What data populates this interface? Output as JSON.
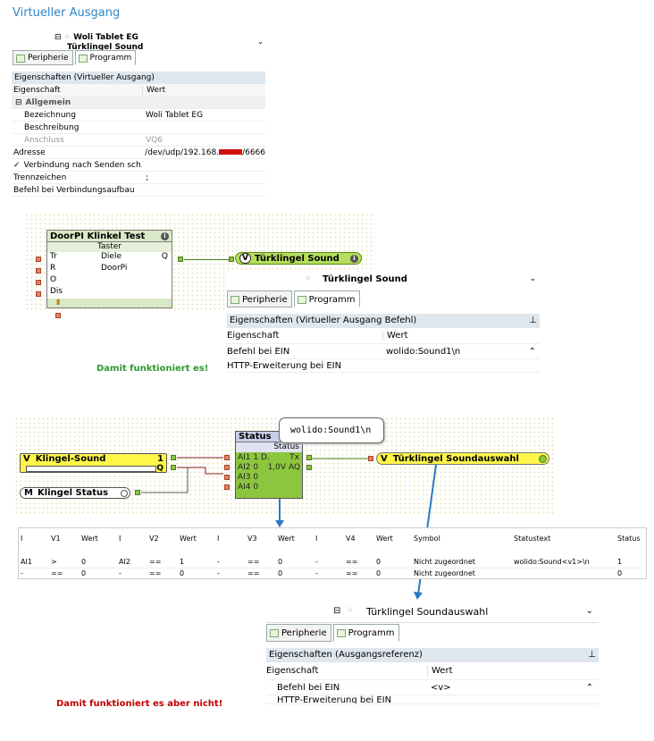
{
  "heading": "Virtueller Ausgang",
  "panel1": {
    "tree_item1": "Woli Tablet EG",
    "tree_item2": "Türklingel Sound",
    "tabs": [
      "Peripherie",
      "Programm"
    ],
    "section_title": "Eigenschaften (Virtueller Ausgang)",
    "col_prop": "Eigenschaft",
    "col_val": "Wert",
    "group": "Allgemein",
    "rows": [
      {
        "prop": "Bezeichnung",
        "val": "Woli Tablet EG"
      },
      {
        "prop": "Beschreibung",
        "val": ""
      },
      {
        "prop": "Anschluss",
        "val": "VQ6"
      },
      {
        "prop": "Adresse",
        "val": "/dev/udp/192.168.",
        "val_suffix": "/6666"
      },
      {
        "prop": "Verbindung nach Senden sch...",
        "val": ""
      },
      {
        "prop": "Trennzeichen",
        "val": ";"
      },
      {
        "prop": "Befehl bei Verbindungsaufbau",
        "val": ""
      }
    ],
    "check_mark": "✓"
  },
  "diagram1": {
    "block_title": "DoorPI Klinkel Test",
    "block_sub": "Taster",
    "inputs": [
      "Tr",
      "R",
      "O",
      "Dis"
    ],
    "mid_labels": [
      "Diele",
      "DoorPi"
    ],
    "output": "Q",
    "vout_tag": "V",
    "vout_label": "Türklingel Sound"
  },
  "panel2": {
    "title": "Türklingel Sound",
    "tabs": [
      "Peripherie",
      "Programm"
    ],
    "section_title": "Eigenschaften (Virtueller Ausgang Befehl)",
    "col_prop": "Eigenschaft",
    "col_val": "Wert",
    "rows": [
      {
        "prop": "Befehl bei EIN",
        "val": "wolido:Sound1\\n"
      },
      {
        "prop": "HTTP-Erweiterung bei EIN",
        "val": ""
      }
    ]
  },
  "works_text": "Damit funktioniert es!",
  "diagram2": {
    "klingel_tag": "V",
    "klingel_label": "Klingel-Sound",
    "klingel_value": "1",
    "klingel_q": "Q",
    "status_tag": "M",
    "status_label": "Klingel Status",
    "block_title": "Status",
    "block_sub": "Status",
    "inputs": [
      "AI1 1 D.",
      "AI2 0",
      "AI3 0",
      "AI4 0"
    ],
    "outputs": [
      "Tx",
      "1,0V AQ"
    ],
    "tooltip": "wolido:Sound1\\n",
    "vout_tag": "V",
    "vout_label": "Türklingel Soundauswahl"
  },
  "table": {
    "headers": [
      "I",
      "V1",
      "Wert",
      "I",
      "V2",
      "Wert",
      "I",
      "V3",
      "Wert",
      "I",
      "V4",
      "Wert",
      "Symbol",
      "Statustext",
      "Status"
    ],
    "rows": [
      [
        "AI1",
        ">",
        "0",
        "AI2",
        "==",
        "1",
        "-",
        "==",
        "0",
        "-",
        "==",
        "0",
        "Nicht zugeordnet",
        "wolido:Sound<v1>\\n",
        "1"
      ],
      [
        "-",
        "==",
        "0",
        "-",
        "==",
        "0",
        "-",
        "==",
        "0",
        "-",
        "==",
        "0",
        "Nicht zugeordnet",
        "",
        "0"
      ]
    ]
  },
  "panel3": {
    "title": "Türklingel Soundauswahl",
    "tabs": [
      "Peripherie",
      "Programm"
    ],
    "section_title": "Eigenschaften (Ausgangsreferenz)",
    "col_prop": "Eigenschaft",
    "col_val": "Wert",
    "rows": [
      {
        "prop": "Befehl bei EIN",
        "val": "<v>"
      },
      {
        "prop": "HTTP-Erweiterung bei EIN",
        "val": ""
      }
    ]
  },
  "fails_text": "Damit funktioniert es aber nicht!",
  "colors": {
    "heading": "#2f86c6",
    "works": "#2e9a2e",
    "fails": "#c00000",
    "arrow": "#2b79c2"
  }
}
